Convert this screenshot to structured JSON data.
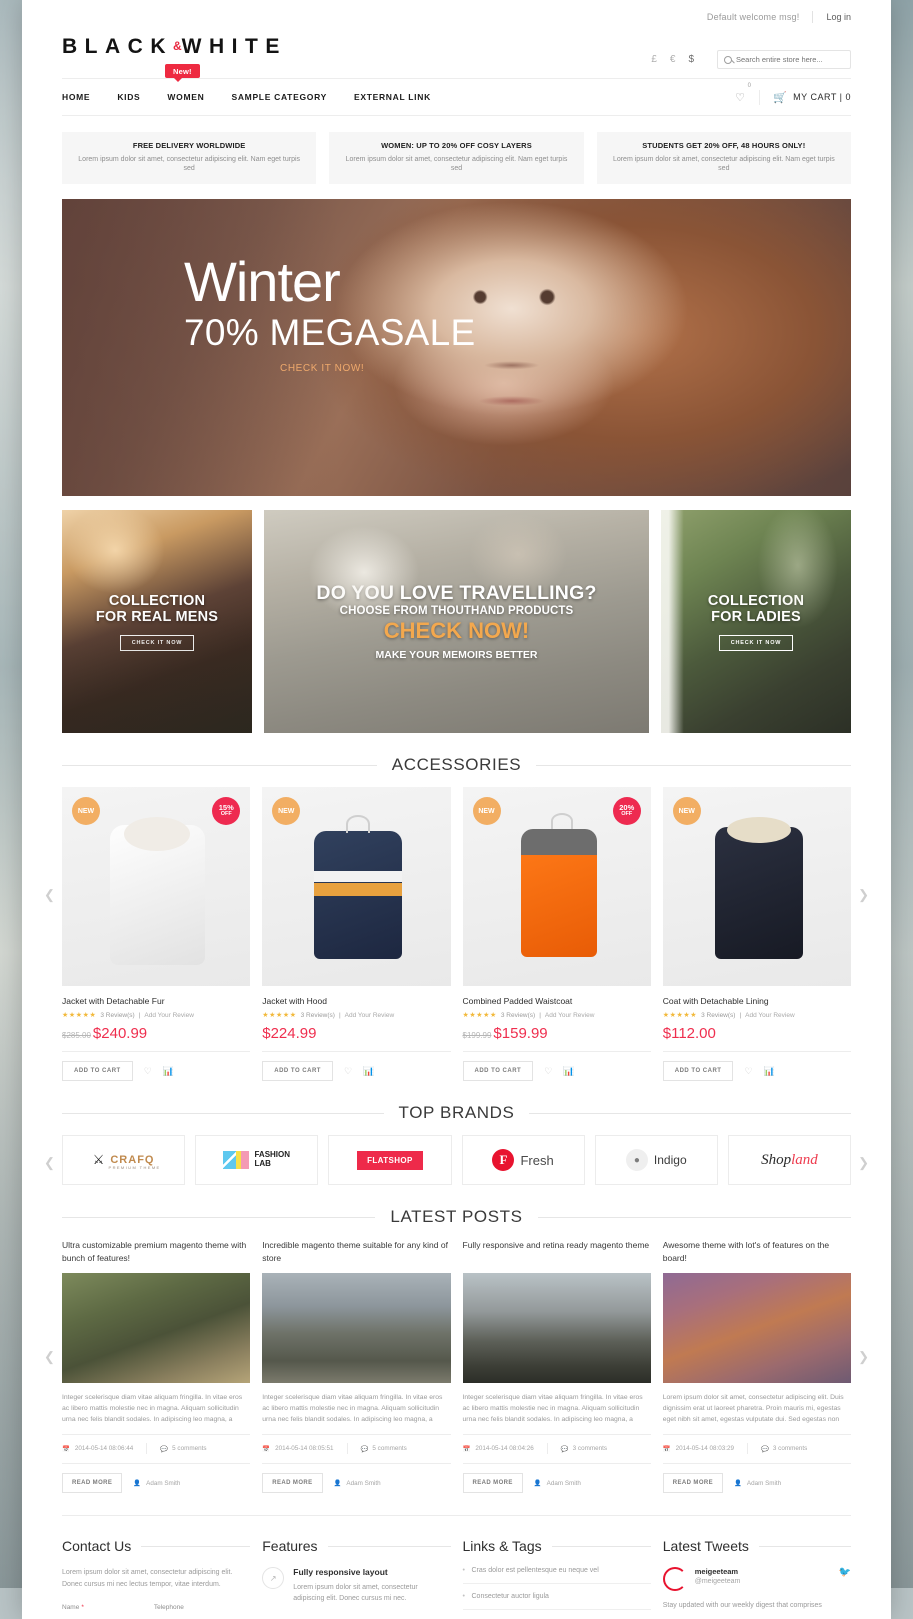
{
  "topbar": {
    "welcome": "Default welcome msg!",
    "login": "Log in"
  },
  "header": {
    "logo_left": "BLACK",
    "logo_amp": "&",
    "logo_right": "WHITE",
    "currencies": [
      "£",
      "€",
      "$"
    ],
    "search_placeholder": "Search entire store here...",
    "new_badge": "New!",
    "wishlist_count": "0",
    "cart_label": "MY CART  |  0"
  },
  "nav": {
    "items": [
      "HOME",
      "KIDS",
      "WOMEN",
      "SAMPLE CATEGORY",
      "EXTERNAL LINK"
    ]
  },
  "promos": [
    {
      "title": "FREE DELIVERY WORLDWIDE",
      "text": "Lorem ipsum dolor sit amet, consectetur adipiscing elit. Nam eget turpis sed"
    },
    {
      "title": "WOMEN: UP TO 20% OFF COSY LAYERS",
      "text": "Lorem ipsum dolor sit amet, consectetur adipiscing elit. Nam eget turpis sed"
    },
    {
      "title": "STUDENTS GET 20% OFF, 48 HOURS ONLY!",
      "text": "Lorem ipsum dolor sit amet, consectetur adipiscing elit. Nam eget turpis sed"
    }
  ],
  "hero": {
    "line1": "Winter",
    "line2": "70% MEGASALE",
    "cta": "CHECK IT NOW!"
  },
  "tiles": {
    "mens": {
      "title": "COLLECTION\nFOR REAL MENS",
      "line1": "COLLECTION",
      "line2": "FOR REAL MENS",
      "button": "CHECK IT NOW"
    },
    "travel": {
      "line1": "DO YOU LOVE TRAVELLING?",
      "line2": "CHOOSE FROM THOUTHAND PRODUCTS",
      "line3": "CHECK NOW!",
      "line4": "MAKE YOUR MEMOIRS BETTER"
    },
    "ladies": {
      "line1": "COLLECTION",
      "line2": "FOR LADIES",
      "button": "CHECK IT NOW"
    }
  },
  "sections": {
    "accessories": "ACCESSORIES",
    "top_brands": "TOP BRANDS",
    "latest_posts": "LATEST POSTS"
  },
  "products": [
    {
      "name": "Jacket with Detachable Fur",
      "badge_new": "NEW",
      "badge_off_pct": "15%",
      "badge_off_label": "OFF",
      "reviews": "3 Review(s)",
      "add_review": "Add Your Review",
      "old_price": "$285.00",
      "price": "$240.99",
      "add_to_cart": "ADD TO CART",
      "stars": "★★★★★"
    },
    {
      "name": "Jacket with Hood",
      "badge_new": "NEW",
      "badge_off_pct": "",
      "badge_off_label": "",
      "reviews": "3 Review(s)",
      "add_review": "Add Your Review",
      "old_price": "",
      "price": "$224.99",
      "add_to_cart": "ADD TO CART",
      "stars": "★★★★★"
    },
    {
      "name": "Combined Padded Waistcoat",
      "badge_new": "NEW",
      "badge_off_pct": "20%",
      "badge_off_label": "OFF",
      "reviews": "3 Review(s)",
      "add_review": "Add Your Review",
      "old_price": "$199.99",
      "price": "$159.99",
      "add_to_cart": "ADD TO CART",
      "stars": "★★★★★"
    },
    {
      "name": "Coat with Detachable Lining",
      "badge_new": "NEW",
      "badge_off_pct": "",
      "badge_off_label": "",
      "reviews": "3 Review(s)",
      "add_review": "Add Your Review",
      "old_price": "",
      "price": "$112.00",
      "add_to_cart": "ADD TO CART",
      "stars": "★★★★★"
    }
  ],
  "brands": [
    {
      "name": "CRAFQ",
      "sub": "PREMIUM THEME"
    },
    {
      "name": "FASHION",
      "sub": "LAB"
    },
    {
      "name": "FLATSHOP",
      "sub": ""
    },
    {
      "name": "Fresh",
      "sub": "F"
    },
    {
      "name": "Indigo",
      "sub": ""
    },
    {
      "name_a": "Shop",
      "name_b": "land"
    }
  ],
  "posts": [
    {
      "title": "Ultra customizable premium magento theme with bunch of features!",
      "excerpt": "Integer scelerisque diam vitae aliquam fringilla. In vitae eros ac libero mattis molestie nec in magna. Aliquam sollicitudin urna nec felis blandit sodales. In adipiscing leo magna, a",
      "date": "2014-05-14 08:06:44",
      "comments": "5 comments",
      "read_more": "READ MORE",
      "author": "Adam Smith"
    },
    {
      "title": "Incredible magento theme suitable for any kind of store",
      "excerpt": "Integer scelerisque diam vitae aliquam fringilla. In vitae eros ac libero mattis molestie nec in magna. Aliquam sollicitudin urna nec felis blandit sodales. In adipiscing leo magna, a",
      "date": "2014-05-14 08:05:51",
      "comments": "5 comments",
      "read_more": "READ MORE",
      "author": "Adam Smith"
    },
    {
      "title": "Fully responsive and retina ready magento theme",
      "excerpt": "Integer scelerisque diam vitae aliquam fringilla. In vitae eros ac libero mattis molestie nec in magna. Aliquam sollicitudin urna nec felis blandit sodales. In adipiscing leo magna, a",
      "date": "2014-05-14 08:04:26",
      "comments": "3 comments",
      "read_more": "READ MORE",
      "author": "Adam Smith"
    },
    {
      "title": "Awesome theme with lot's of features on the board!",
      "excerpt": "Lorem ipsum dolor sit amet, consectetur adipiscing elit. Duis dignissim erat ut laoreet pharetra. Proin mauris mi, egestas eget nibh sit amet, egestas vulputate dui. Sed egestas non",
      "date": "2014-05-14 08:03:29",
      "comments": "3 comments",
      "read_more": "READ MORE",
      "author": "Adam Smith"
    }
  ],
  "footer": {
    "contact": {
      "heading": "Contact Us",
      "text": "Lorem ipsum dolor sit amet, consectetur adipiscing elit. Donec cursus mi nec lectus tempor, vitae interdum.",
      "label_name": "Name",
      "label_phone": "Telephone"
    },
    "features": {
      "heading": "Features",
      "item_title": "Fully responsive layout",
      "item_text": "Lorem ipsum dolor sit amet, consectetur adipiscing elit. Donec cursus mi nec."
    },
    "links": {
      "heading": "Links & Tags",
      "items": [
        "Cras dolor est pellentesque eu neque vel",
        "Consectetur auctor ligula"
      ]
    },
    "tweets": {
      "heading": "Latest Tweets",
      "name": "meigeeteam",
      "handle": "@meigeeteam",
      "text": "Stay updated with our weekly digest that comprises"
    }
  },
  "colors": {
    "accent_red": "#ee2a41",
    "price_red": "#ef2e4e",
    "badge_orange": "#f2ae63",
    "star_gold": "#f2b93c",
    "cta_orange": "#efa96c"
  }
}
